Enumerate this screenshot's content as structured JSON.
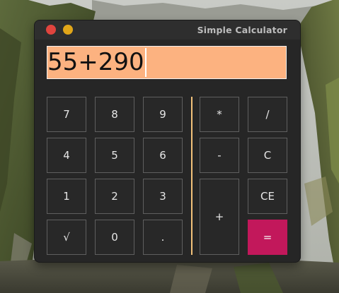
{
  "window": {
    "title": "Simple Calculator"
  },
  "display": {
    "expression": "55+290"
  },
  "keypad": {
    "digits": {
      "k7": "7",
      "k8": "8",
      "k9": "9",
      "k4": "4",
      "k5": "5",
      "k6": "6",
      "k1": "1",
      "k2": "2",
      "k3": "3",
      "sqrt": "√",
      "k0": "0",
      "dot": "."
    },
    "operators": {
      "multiply": "*",
      "divide": "/",
      "minus": "-",
      "clear": "C",
      "plus": "+",
      "clear_entry": "CE",
      "equals": "="
    }
  },
  "colors": {
    "display_background": "#fcb280",
    "equals_button": "#c2185b",
    "divider": "#f3c27a"
  }
}
